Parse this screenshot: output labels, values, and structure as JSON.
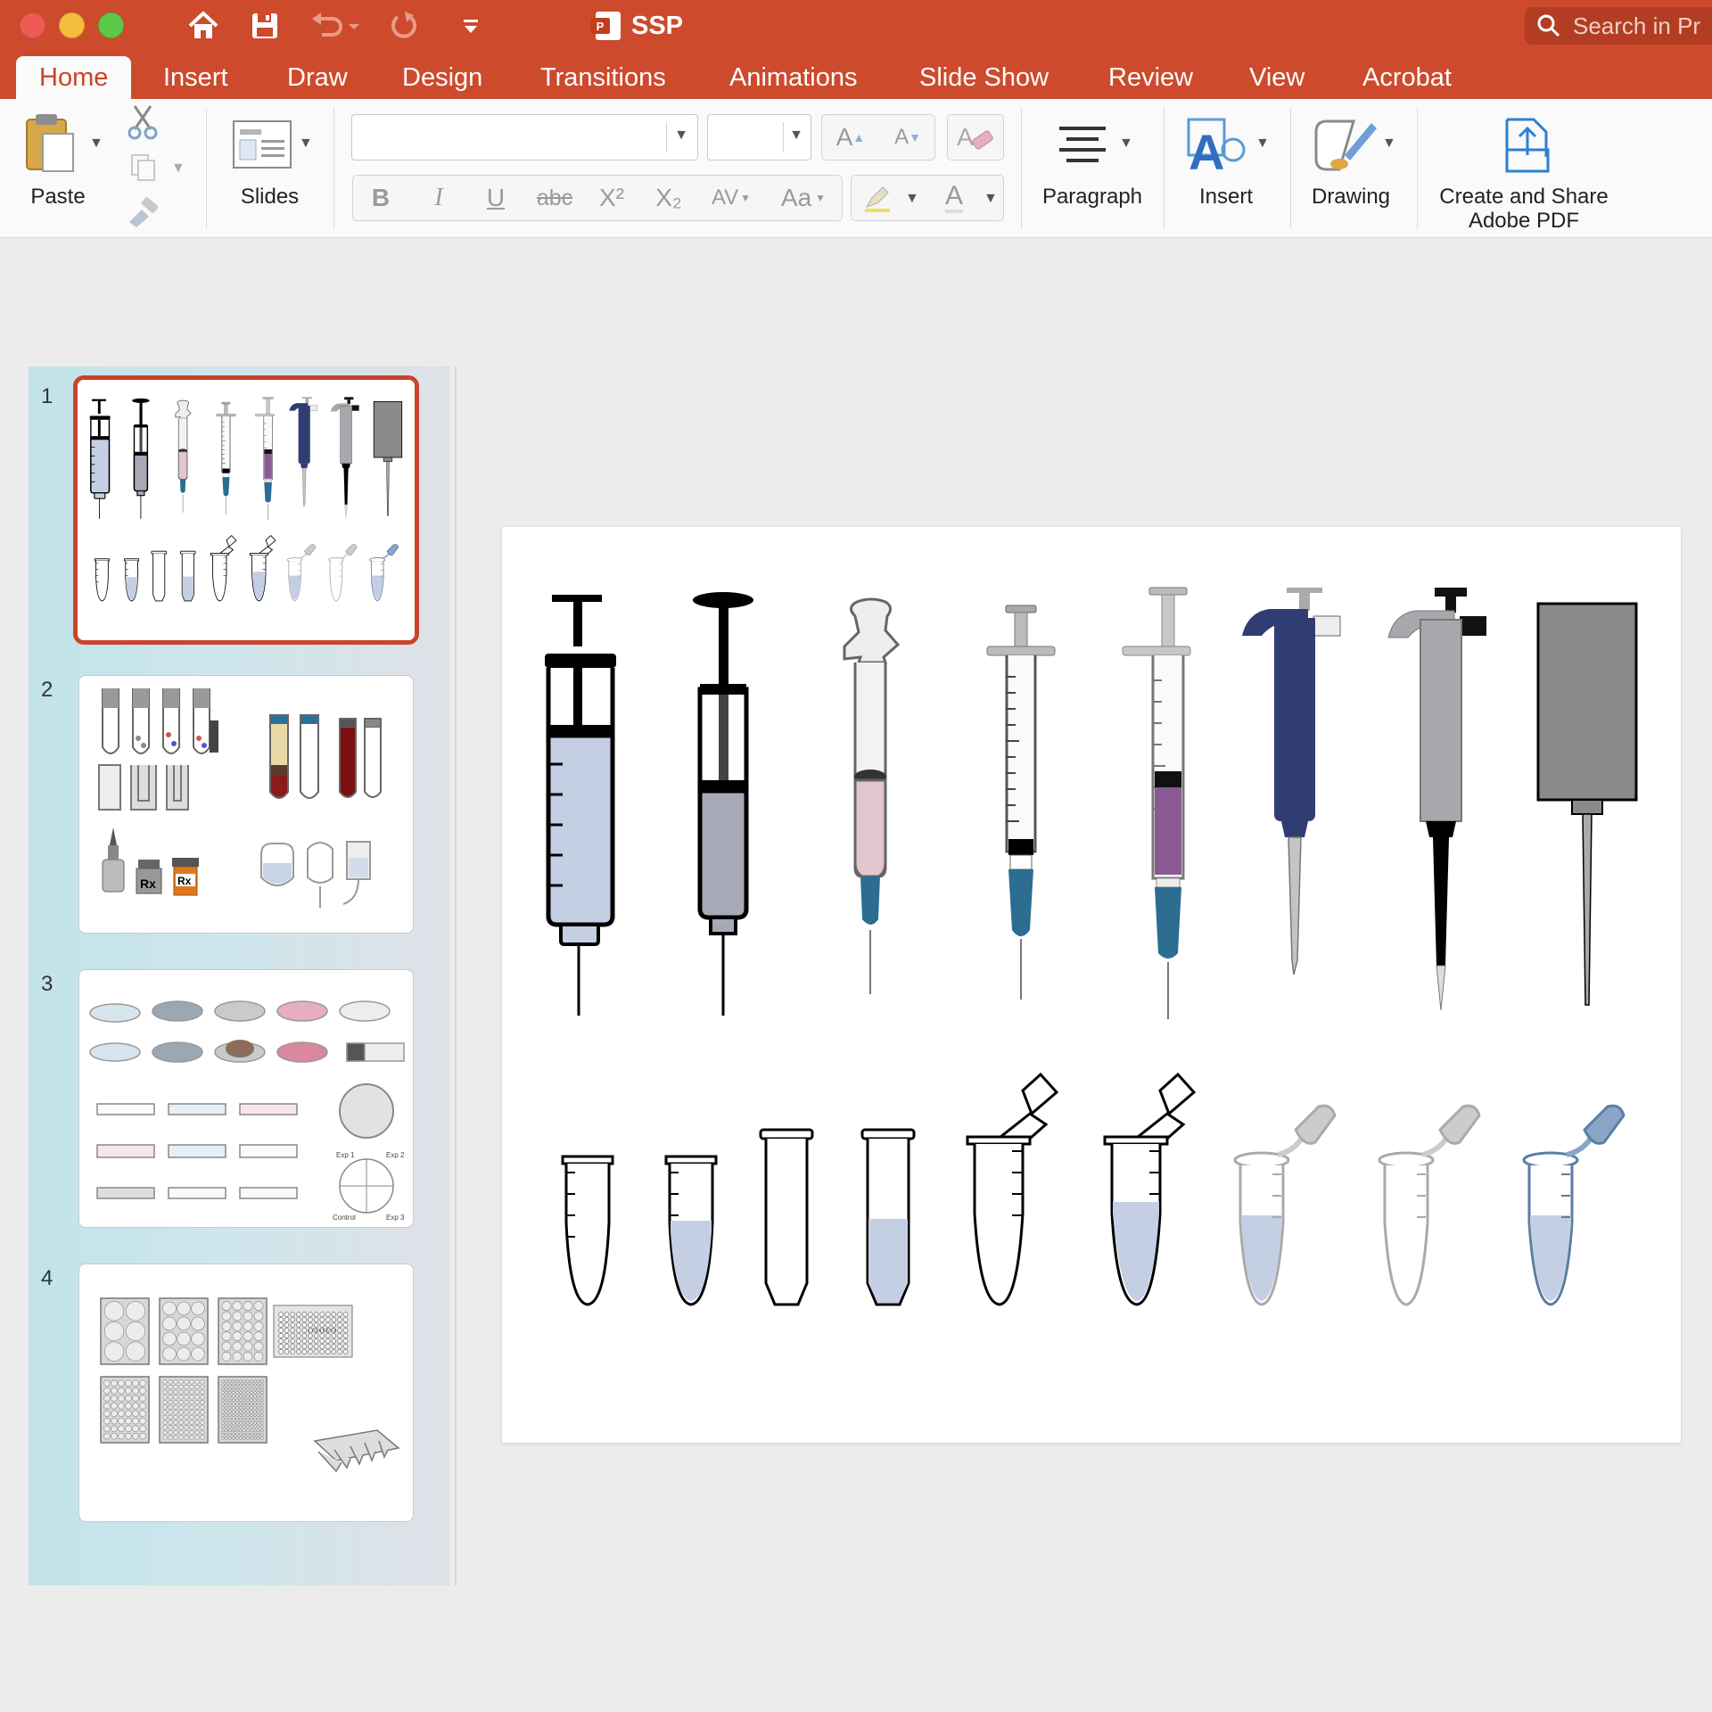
{
  "window": {
    "title": "SSP",
    "search_placeholder": "Search in Pr"
  },
  "tabs": [
    {
      "label": "Home",
      "active": true
    },
    {
      "label": "Insert"
    },
    {
      "label": "Draw"
    },
    {
      "label": "Design"
    },
    {
      "label": "Transitions"
    },
    {
      "label": "Animations"
    },
    {
      "label": "Slide Show"
    },
    {
      "label": "Review"
    },
    {
      "label": "View"
    },
    {
      "label": "Acrobat"
    }
  ],
  "ribbon": {
    "paste_label": "Paste",
    "slides_label": "Slides",
    "paragraph_label": "Paragraph",
    "insert_label": "Insert",
    "drawing_label": "Drawing",
    "create_pdf_line1": "Create and Share",
    "create_pdf_line2": "Adobe PDF",
    "font_name_value": "",
    "font_size_value": "",
    "format_buttons": {
      "bold": "B",
      "italic": "I",
      "underline": "U",
      "strike": "abc",
      "superscript": "X²",
      "subscript": "X₂",
      "spacing": "AV",
      "change_case": "Aa",
      "font_color": "A",
      "grow": "A",
      "shrink": "A"
    }
  },
  "slides": [
    {
      "number": "1",
      "selected": true
    },
    {
      "number": "2"
    },
    {
      "number": "3"
    },
    {
      "number": "4"
    }
  ],
  "thumb3_labels": {
    "exp1": "Exp 1",
    "exp2": "Exp 2",
    "control": "Control",
    "exp3": "Exp 3"
  },
  "thumb4_plate_header": "1 2 3 4 5 6 7 8",
  "thumb2_rx": "Rx",
  "colors": {
    "accent": "#c8452a",
    "titlebar": "#cd4a2c",
    "selected_border": "#c9442b",
    "pipette_blue": "#2f3d73",
    "pipette_grey": "#a6a8ab",
    "liquid_blue": "#c5cfe3",
    "liquid_pink": "#e2c5cf",
    "liquid_purple": "#8b5a94",
    "needle_hub": "#2c6d91"
  }
}
